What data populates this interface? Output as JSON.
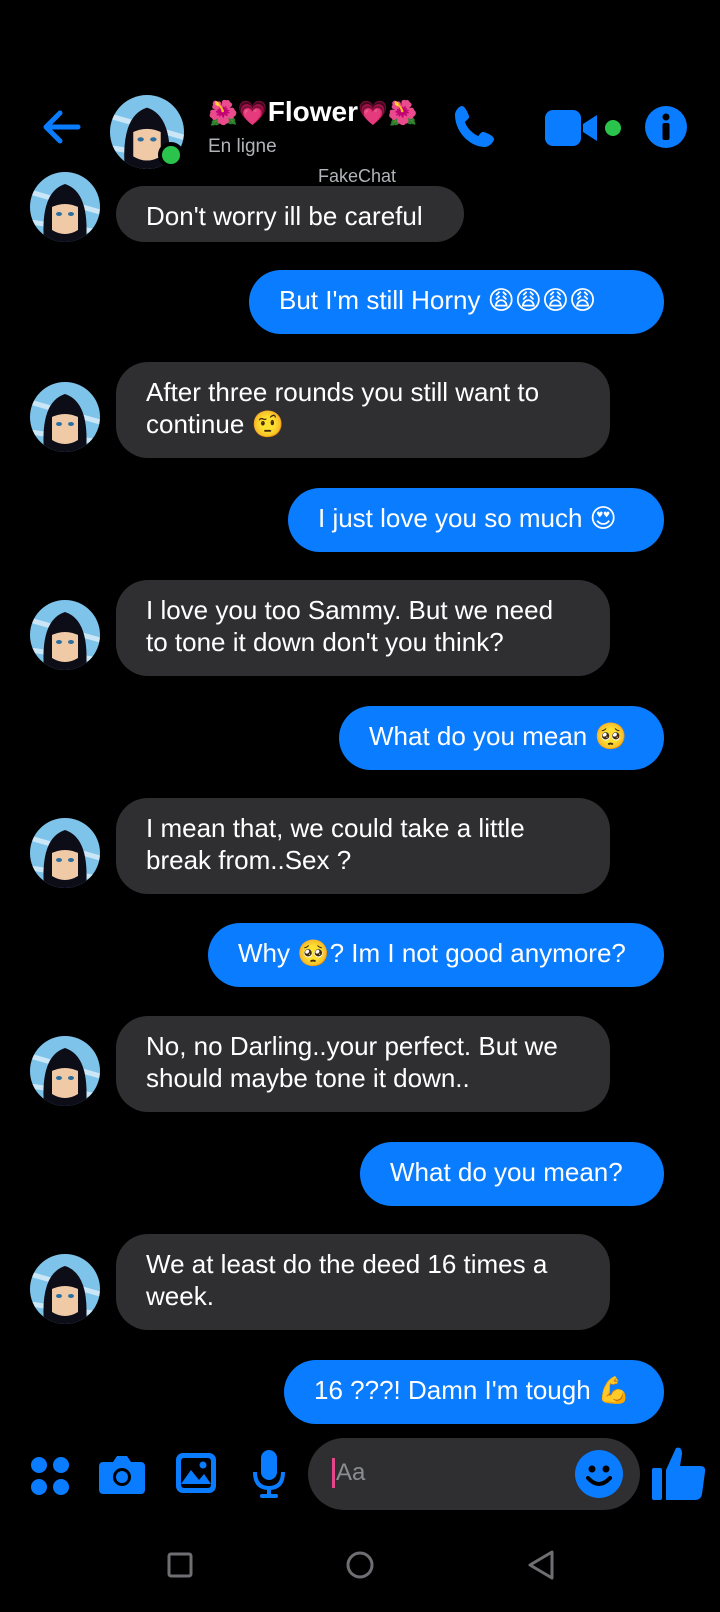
{
  "header": {
    "back_icon": "arrow-left-icon",
    "contact_name_prefix": "🌺💗",
    "contact_name": "Flower",
    "contact_name_suffix": "💗🌺",
    "status": "En ligne",
    "watermark": "FakeChat",
    "call_icon": "phone-icon",
    "video_icon": "video-camera-icon",
    "info_icon": "info-icon"
  },
  "messages": [
    {
      "side": "in",
      "text": "Don't worry ill be careful"
    },
    {
      "side": "out",
      "text": "But I'm still Horny 😩😩😩😩"
    },
    {
      "side": "in",
      "text": "After three rounds you still want to\ncontinue 🤨"
    },
    {
      "side": "out",
      "text": "I just love you so much 😍"
    },
    {
      "side": "in",
      "text": "I love you too Sammy. But we need\nto tone it down don't you think?"
    },
    {
      "side": "out",
      "text": "What do you mean 🥺"
    },
    {
      "side": "in",
      "text": "I mean that, we could take a little\nbreak from..Sex ?"
    },
    {
      "side": "out",
      "text": "Why 🥺? Im I not good anymore?"
    },
    {
      "side": "in",
      "text": "No, no Darling..your perfect. But we\nshould maybe tone it down.."
    },
    {
      "side": "out",
      "text": "What do you mean?"
    },
    {
      "side": "in",
      "text": "We at least do the deed 16 times a\nweek."
    },
    {
      "side": "out",
      "text": "16 ???! Damn I'm tough 💪"
    }
  ],
  "composer": {
    "placeholder": "Aa",
    "icons": [
      "apps-icon",
      "camera-icon",
      "gallery-icon",
      "microphone-icon",
      "emoji-icon",
      "thumbs-up-icon"
    ]
  },
  "navbar": {
    "icons": [
      "recents-square-icon",
      "home-circle-icon",
      "back-triangle-icon"
    ]
  },
  "colors": {
    "accent": "#0a7cff",
    "incoming_bubble": "#2f2f31",
    "background": "#000000",
    "online": "#2ac44d"
  }
}
